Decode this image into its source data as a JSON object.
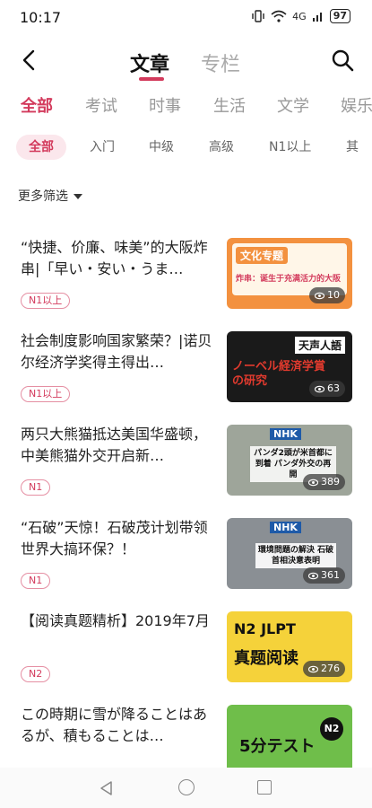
{
  "status": {
    "time": "10:17",
    "signal": "4G",
    "battery": "97"
  },
  "header": {
    "tab_active": "文章",
    "tab_other": "专栏"
  },
  "categories": [
    "全部",
    "考试",
    "时事",
    "生活",
    "文学",
    "娱乐"
  ],
  "levels": [
    "全部",
    "入门",
    "中级",
    "高级",
    "N1以上",
    "其"
  ],
  "filter": "更多筛选",
  "articles": [
    {
      "title": "“快捷、价廉、味美”的大阪炸串|「早い・安い・うま…",
      "tag": "N1以上",
      "views": "10",
      "thumb_line1": "文化专题",
      "thumb_line2": "炸串：诞生于充满活力的大阪"
    },
    {
      "title": "社会制度影响国家繁荣？|诺贝尔经济学奖得主得出…",
      "tag": "N1以上",
      "views": "63",
      "thumb_line1": "天声人語",
      "thumb_line2": "ノーベル経済学賞の研究"
    },
    {
      "title": "两只大熊猫抵达美国华盛顿，中美熊猫外交开启新…",
      "tag": "N1",
      "views": "389",
      "thumb_line1": "NHK",
      "thumb_line2": "パンダ2頭が米首都に到着 パンダ外交の再開"
    },
    {
      "title": "“石破”天惊！石破茂计划带领世界大搞环保？！",
      "tag": "N1",
      "views": "361",
      "thumb_line1": "NHK",
      "thumb_line2": "環境問題の解決 石破首相決意表明"
    },
    {
      "title": "【阅读真题精析】2019年7月",
      "tag": "N2",
      "views": "276",
      "thumb_line1": "N2 JLPT",
      "thumb_line2": "真题阅读"
    },
    {
      "title": "この時期に雪が降ることはあるが、積もることは…",
      "tag": "",
      "views": "",
      "thumb_line1": "N2",
      "thumb_line2": "5分テスト"
    }
  ],
  "colors": {
    "accent": "#d33a5c",
    "orange": "#f3913f",
    "yellow": "#f5d23a",
    "green": "#6fbe4a"
  }
}
